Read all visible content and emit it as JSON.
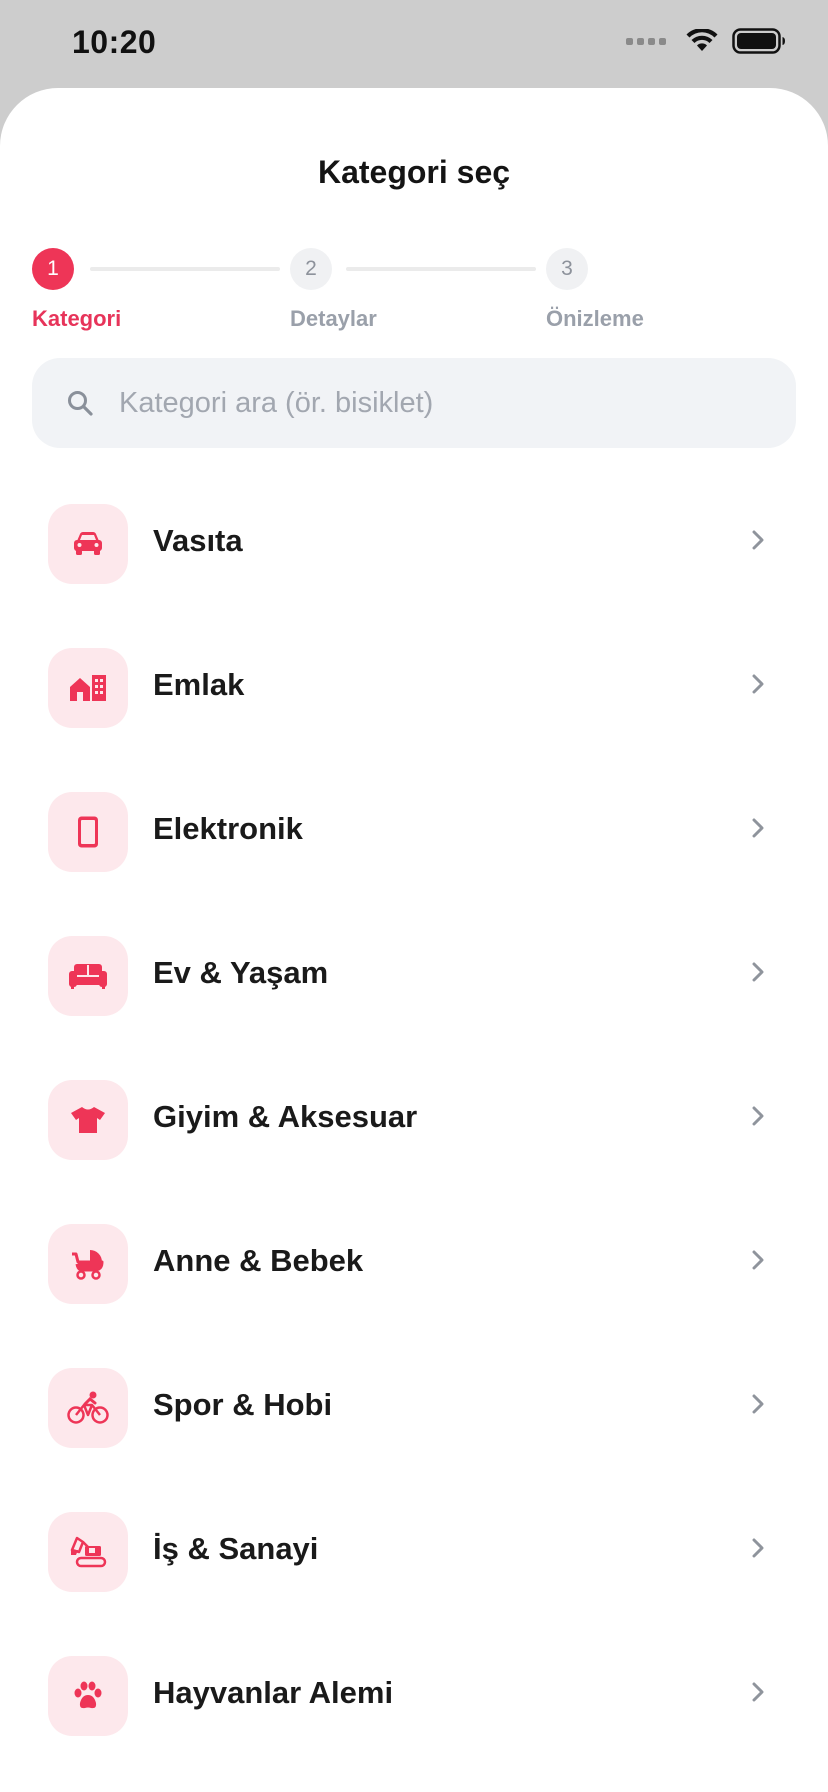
{
  "status": {
    "time": "10:20"
  },
  "sheet": {
    "title": "Kategori seç"
  },
  "stepper": {
    "steps": [
      {
        "number": "1",
        "label": "Kategori",
        "active": true
      },
      {
        "number": "2",
        "label": "Detaylar",
        "active": false
      },
      {
        "number": "3",
        "label": "Önizleme",
        "active": false
      }
    ]
  },
  "search": {
    "placeholder": "Kategori ara (ör. bisiklet)"
  },
  "categories": [
    {
      "label": "Vasıta",
      "icon": "car-icon"
    },
    {
      "label": "Emlak",
      "icon": "building-icon"
    },
    {
      "label": "Elektronik",
      "icon": "phone-icon"
    },
    {
      "label": "Ev & Yaşam",
      "icon": "sofa-icon"
    },
    {
      "label": "Giyim & Aksesuar",
      "icon": "tshirt-icon"
    },
    {
      "label": "Anne & Bebek",
      "icon": "stroller-icon"
    },
    {
      "label": "Spor & Hobi",
      "icon": "bicycle-icon"
    },
    {
      "label": "İş & Sanayi",
      "icon": "excavator-icon"
    },
    {
      "label": "Hayvanlar Alemi",
      "icon": "paw-icon"
    }
  ],
  "colors": {
    "accent": "#ee3557",
    "icon_bg": "#fde8ec",
    "search_bg": "#f1f3f6",
    "muted": "#9aa0aa"
  }
}
